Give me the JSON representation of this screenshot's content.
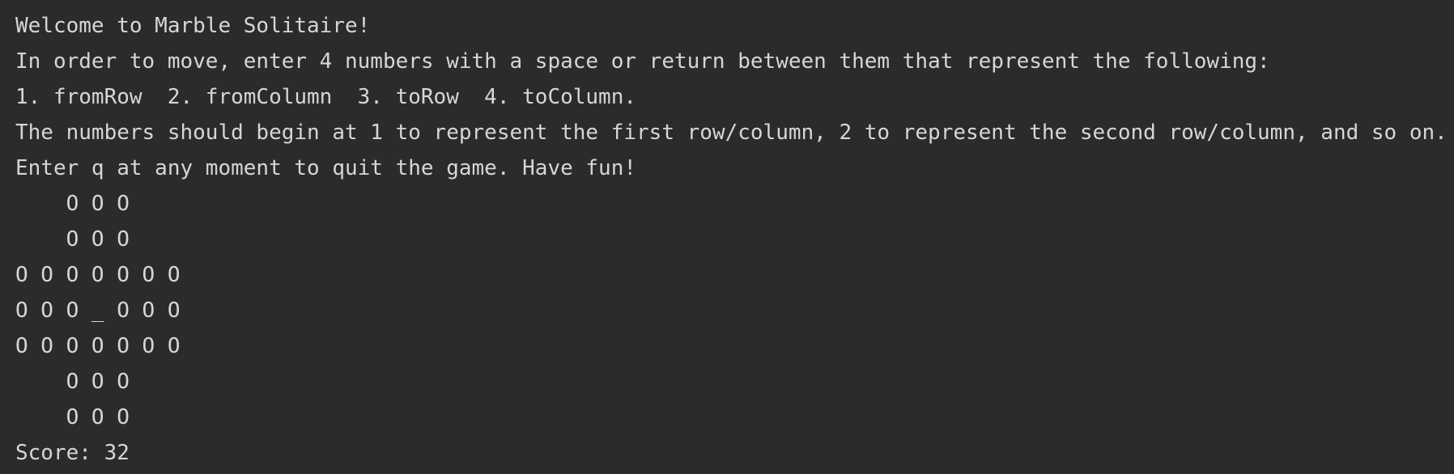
{
  "console": {
    "intro": [
      "Welcome to Marble Solitaire!",
      "In order to move, enter 4 numbers with a space or return between them that represent the following:",
      "1. fromRow  2. fromColumn  3. toRow  4. toColumn.",
      "The numbers should begin at 1 to represent the first row/column, 2 to represent the second row/column, and so on.",
      "Enter q at any moment to quit the game. Have fun!"
    ],
    "board": [
      "    O O O",
      "    O O O",
      "O O O O O O O",
      "O O O _ O O O",
      "O O O O O O O",
      "    O O O",
      "    O O O"
    ],
    "score": "Score: 32"
  }
}
